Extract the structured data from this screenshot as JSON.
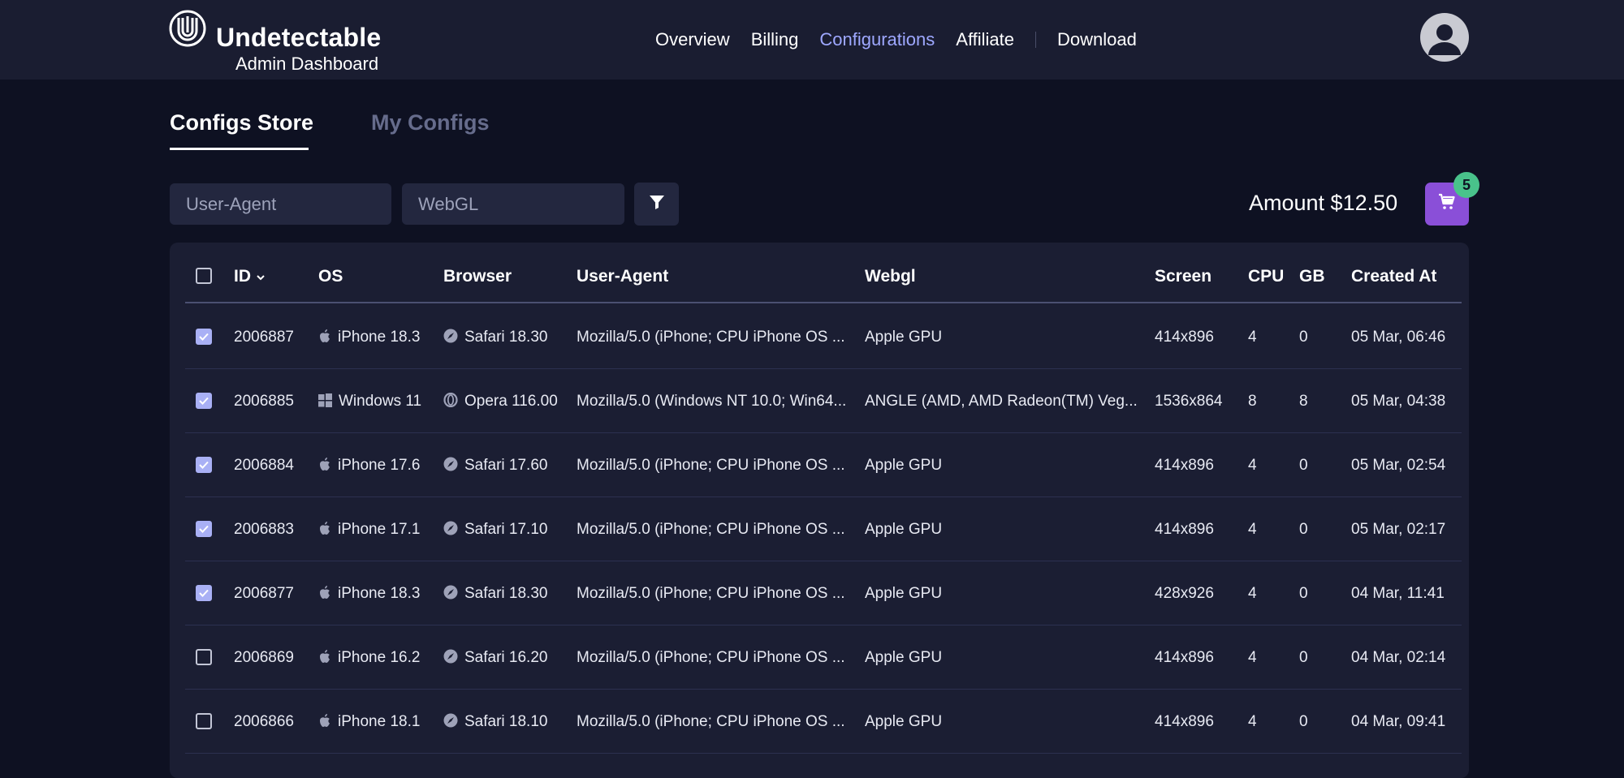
{
  "brand": {
    "name": "Undetectable",
    "subtitle": "Admin Dashboard",
    "logo_icon": "undetectable-logo-icon"
  },
  "nav": {
    "items": [
      {
        "label": "Overview",
        "active": false
      },
      {
        "label": "Billing",
        "active": false
      },
      {
        "label": "Configurations",
        "active": true
      },
      {
        "label": "Affiliate",
        "active": false
      },
      {
        "label": "Download",
        "active": false
      }
    ],
    "active_color": "#9ea8ff"
  },
  "user": {
    "avatar_icon": "user-avatar-icon"
  },
  "tabs": [
    {
      "label": "Configs Store",
      "active": true
    },
    {
      "label": "My Configs",
      "active": false
    }
  ],
  "filters": {
    "user_agent_placeholder": "User-Agent",
    "user_agent_value": "",
    "webgl_placeholder": "WebGL",
    "webgl_value": "",
    "filter_icon": "filter-icon"
  },
  "cart": {
    "amount_text": "Amount $12.50",
    "count": "5",
    "cart_icon": "shopping-cart-icon",
    "button_color": "#8a4fd8",
    "badge_color": "#49c28b"
  },
  "table": {
    "headers": {
      "id": "ID",
      "os": "OS",
      "browser": "Browser",
      "user_agent": "User-Agent",
      "webgl": "Webgl",
      "screen": "Screen",
      "cpu": "CPU",
      "gb": "GB",
      "created_at": "Created At"
    },
    "sort_column": "ID",
    "rows": [
      {
        "checked": true,
        "id": "2006887",
        "os_icon": "apple-icon",
        "os": "iPhone 18.3",
        "browser_icon": "safari-icon",
        "browser": "Safari 18.30",
        "user_agent": "Mozilla/5.0 (iPhone; CPU iPhone OS ...",
        "webgl": "Apple GPU",
        "screen": "414x896",
        "cpu": "4",
        "gb": "0",
        "created_at": "05 Mar, 06:46"
      },
      {
        "checked": true,
        "id": "2006885",
        "os_icon": "windows-icon",
        "os": "Windows 11",
        "browser_icon": "opera-icon",
        "browser": "Opera 116.00",
        "user_agent": "Mozilla/5.0 (Windows NT 10.0; Win64...",
        "webgl": "ANGLE (AMD, AMD Radeon(TM) Veg...",
        "screen": "1536x864",
        "cpu": "8",
        "gb": "8",
        "created_at": "05 Mar, 04:38"
      },
      {
        "checked": true,
        "id": "2006884",
        "os_icon": "apple-icon",
        "os": "iPhone 17.6",
        "browser_icon": "safari-icon",
        "browser": "Safari 17.60",
        "user_agent": "Mozilla/5.0 (iPhone; CPU iPhone OS ...",
        "webgl": "Apple GPU",
        "screen": "414x896",
        "cpu": "4",
        "gb": "0",
        "created_at": "05 Mar, 02:54"
      },
      {
        "checked": true,
        "id": "2006883",
        "os_icon": "apple-icon",
        "os": "iPhone 17.1",
        "browser_icon": "safari-icon",
        "browser": "Safari 17.10",
        "user_agent": "Mozilla/5.0 (iPhone; CPU iPhone OS ...",
        "webgl": "Apple GPU",
        "screen": "414x896",
        "cpu": "4",
        "gb": "0",
        "created_at": "05 Mar, 02:17"
      },
      {
        "checked": true,
        "id": "2006877",
        "os_icon": "apple-icon",
        "os": "iPhone 18.3",
        "browser_icon": "safari-icon",
        "browser": "Safari 18.30",
        "user_agent": "Mozilla/5.0 (iPhone; CPU iPhone OS ...",
        "webgl": "Apple GPU",
        "screen": "428x926",
        "cpu": "4",
        "gb": "0",
        "created_at": "04 Mar, 11:41"
      },
      {
        "checked": false,
        "id": "2006869",
        "os_icon": "apple-icon",
        "os": "iPhone 16.2",
        "browser_icon": "safari-icon",
        "browser": "Safari 16.20",
        "user_agent": "Mozilla/5.0 (iPhone; CPU iPhone OS ...",
        "webgl": "Apple GPU",
        "screen": "414x896",
        "cpu": "4",
        "gb": "0",
        "created_at": "04 Mar, 02:14"
      },
      {
        "checked": false,
        "id": "2006866",
        "os_icon": "apple-icon",
        "os": "iPhone 18.1",
        "browser_icon": "safari-icon",
        "browser": "Safari 18.10",
        "user_agent": "Mozilla/5.0 (iPhone; CPU iPhone OS ...",
        "webgl": "Apple GPU",
        "screen": "414x896",
        "cpu": "4",
        "gb": "0",
        "created_at": "04 Mar, 09:41"
      }
    ]
  }
}
